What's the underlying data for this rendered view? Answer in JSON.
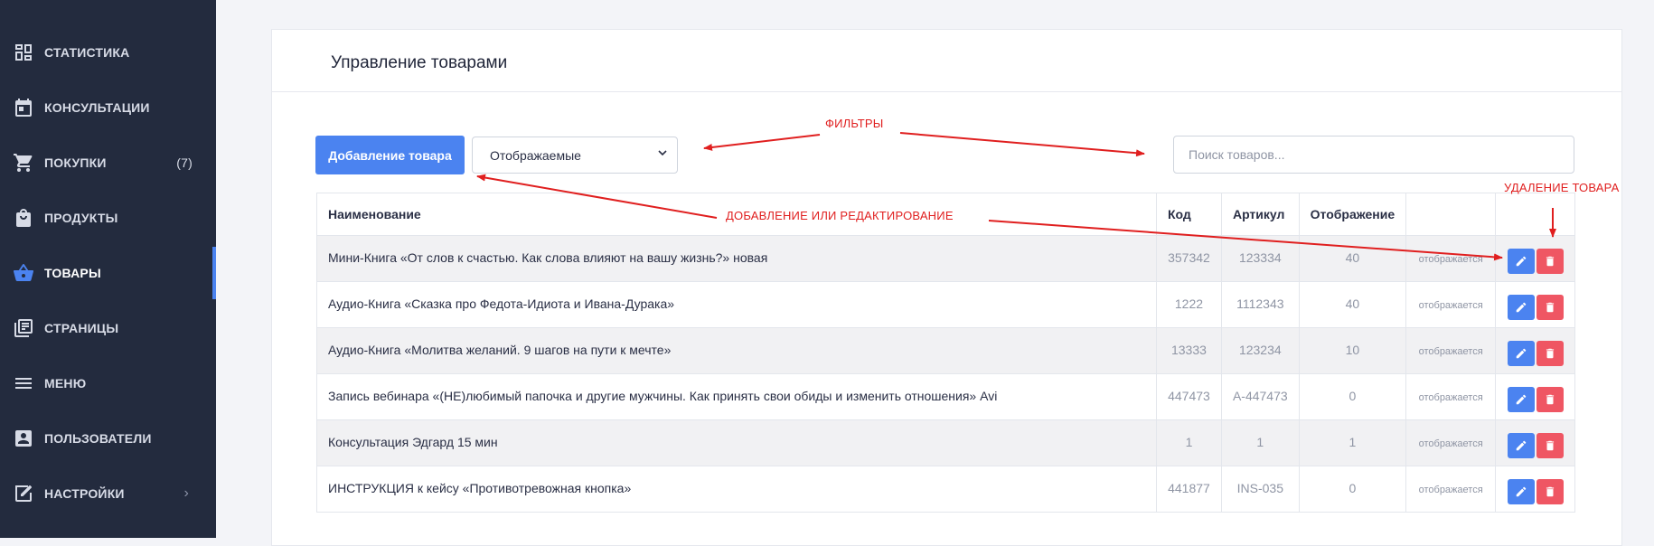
{
  "sidebar": {
    "items": [
      {
        "label": "СТАТИСТИКА",
        "icon": "dashboard-icon",
        "count": "",
        "has_chevron": false,
        "active": false
      },
      {
        "label": "КОНСУЛЬТАЦИИ",
        "icon": "calendar-icon",
        "count": "",
        "has_chevron": false,
        "active": false
      },
      {
        "label": "ПОКУПКИ",
        "icon": "cart-icon",
        "count": "(7)",
        "has_chevron": false,
        "active": false
      },
      {
        "label": "ПРОДУКТЫ",
        "icon": "shopping-bag-icon",
        "count": "",
        "has_chevron": false,
        "active": false
      },
      {
        "label": "ТОВАРЫ",
        "icon": "basket-icon",
        "count": "",
        "has_chevron": false,
        "active": true
      },
      {
        "label": "СТРАНИЦЫ",
        "icon": "library-books-icon",
        "count": "",
        "has_chevron": false,
        "active": false
      },
      {
        "label": "МЕНЮ",
        "icon": "menu-icon",
        "count": "",
        "has_chevron": false,
        "active": false
      },
      {
        "label": "ПОЛЬЗОВАТЕЛИ",
        "icon": "account-box-icon",
        "count": "",
        "has_chevron": false,
        "active": false
      },
      {
        "label": "НАСТРОЙКИ",
        "icon": "edit-settings-icon",
        "count": "",
        "has_chevron": true,
        "active": false
      }
    ]
  },
  "main": {
    "title": "Управление товарами",
    "add_button": "Добавление товара",
    "filter_select": {
      "value": "Отображаемые"
    },
    "search": {
      "placeholder": "Поиск товаров..."
    }
  },
  "table": {
    "headers": {
      "name": "Наименование",
      "code": "Код",
      "article": "Артикул",
      "display": "Отображение",
      "status": "",
      "actions": ""
    },
    "rows": [
      {
        "name": "Мини-Книга «От слов к счастью. Как слова влияют на вашу жизнь?» новая",
        "code": "357342",
        "article": "123334",
        "display": "40",
        "status": "отображается"
      },
      {
        "name": "Аудио-Книга «Сказка про Федота-Идиота и Ивана-Дурака»",
        "code": "1222",
        "article": "1112343",
        "display": "40",
        "status": "отображается"
      },
      {
        "name": "Аудио-Книга «Молитва желаний. 9 шагов на пути к мечте»",
        "code": "13333",
        "article": "123234",
        "display": "10",
        "status": "отображается"
      },
      {
        "name": "Запись вебинара «(НЕ)любимый папочка и другие мужчины. Как принять свои обиды и изменить отношения» Avi",
        "code": "447473",
        "article": "А-447473",
        "display": "0",
        "status": "отображается"
      },
      {
        "name": "Консультация Эдгард 15 мин",
        "code": "1",
        "article": "1",
        "display": "1",
        "status": "отображается"
      },
      {
        "name": "ИНСТРУКЦИЯ к кейсу «Противотревожная кнопка»",
        "code": "441877",
        "article": "INS-035",
        "display": "0",
        "status": "отображается"
      }
    ]
  },
  "annotations": {
    "filters": "ФИЛЬТРЫ",
    "add_edit": "ДОБАВЛЕНИЕ ИЛИ РЕДАКТИРОВАНИЕ",
    "delete": "УДАЛЕНИЕ ТОВАРА",
    "color": "#e01f1f"
  },
  "colors": {
    "sidebar_bg": "#232b3e",
    "accent": "#4b83f0",
    "danger": "#ef5663",
    "page_bg": "#f3f4f8"
  }
}
